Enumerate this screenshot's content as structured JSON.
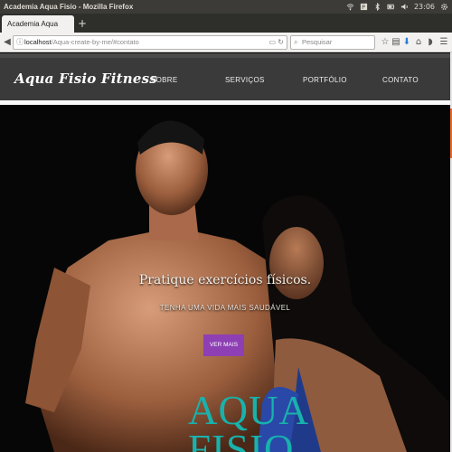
{
  "os": {
    "window_title": "Academia Aqua Fisio - Mozilla Firefox",
    "clock": "23:06"
  },
  "browser": {
    "tab_label": "Academia Aqua Fisio",
    "new_tab_label": "+",
    "url_host": "localhost",
    "url_path": "/Aqua-create-by-me/#contato",
    "search_placeholder": "Pesquisar"
  },
  "site": {
    "logo": "Aqua Fisio Fitness",
    "nav": [
      {
        "label": "SOBRE"
      },
      {
        "label": "SERVIÇOS"
      },
      {
        "label": "PORTFÓLIO"
      },
      {
        "label": "CONTATO"
      }
    ]
  },
  "hero": {
    "title": "Pratique exercícios físicos.",
    "subtitle": "TENHA UMA VIDA MAIS SAUDÁVEL",
    "button_label": "VER MAIS",
    "brand_line1": "AQUA",
    "brand_line2": "FISIO"
  },
  "colors": {
    "accent_button": "#8e3fb4",
    "brand_teal": "#18b2ad",
    "header_bg": "#3a3a3a"
  }
}
